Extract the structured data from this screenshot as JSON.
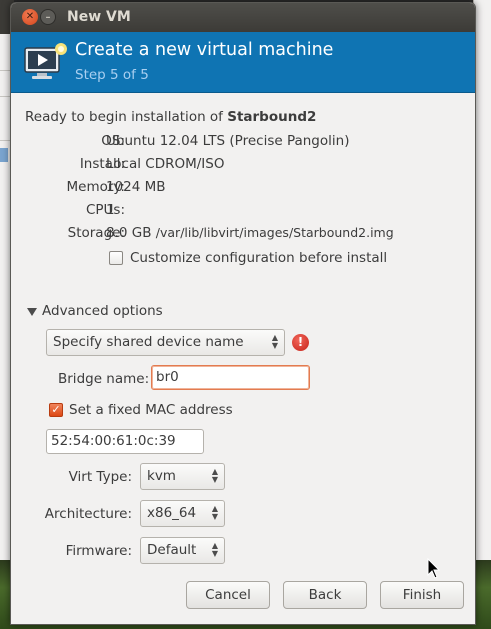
{
  "window": {
    "title": "New VM"
  },
  "banner": {
    "title": "Create a new virtual machine",
    "step": "Step 5 of 5"
  },
  "summary": {
    "ready_prefix": "Ready to begin installation of",
    "vm_name": "Starbound2",
    "rows": [
      {
        "label": "OS:",
        "value": "Ubuntu 12.04 LTS (Precise Pangolin)"
      },
      {
        "label": "Install:",
        "value": "Local CDROM/ISO"
      },
      {
        "label": "Memory:",
        "value": "1024 MB"
      },
      {
        "label": "CPUs:",
        "value": "1"
      }
    ],
    "storage_label": "Storage:",
    "storage_size": "8.0 GB",
    "storage_path": "/var/lib/libvirt/images/Starbound2.img",
    "customize_label": "Customize configuration before install",
    "customize_checked": false
  },
  "advanced": {
    "expander_label": "Advanced options",
    "network_select": "Specify shared device name",
    "bridge_label": "Bridge name:",
    "bridge_value": "br0",
    "mac_label": "Set a fixed MAC address",
    "mac_checked": true,
    "mac_value": "52:54:00:61:0c:39",
    "virt_type_label": "Virt Type:",
    "virt_type_value": "kvm",
    "arch_label": "Architecture:",
    "arch_value": "x86_64",
    "firmware_label": "Firmware:",
    "firmware_value": "Default"
  },
  "buttons": {
    "cancel": "Cancel",
    "back": "Back",
    "finish": "Finish"
  },
  "colors": {
    "banner": "#0f74b3",
    "accent": "#dd4814",
    "window_bg": "#f2f1f0"
  }
}
